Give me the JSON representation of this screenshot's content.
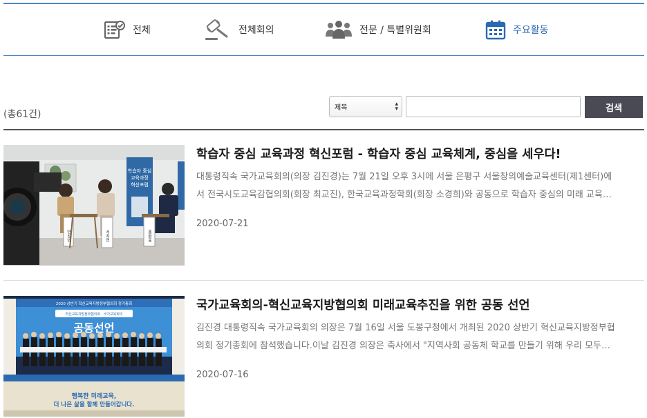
{
  "tabs": [
    {
      "label": "전체",
      "icon": "checklist-icon",
      "active": false
    },
    {
      "label": "전체회의",
      "icon": "gavel-icon",
      "active": false
    },
    {
      "label": "전문 / 특별위원회",
      "icon": "people-group-icon",
      "active": false
    },
    {
      "label": "주요활동",
      "icon": "calendar-icon",
      "active": true
    }
  ],
  "search": {
    "total_count": "(총61건)",
    "select_value": "제목",
    "input_value": "",
    "button_label": "검색"
  },
  "items": [
    {
      "title": "학습자 중심 교육과정 혁신포럼 - 학습자 중심 교육체계, 중심을 세우다!",
      "summary_line1": "대통령직속 국가교육회의(의장 김진경)는 7월 21일 오후 3시에 서울 은평구 서울창의예술교육센터(제1센터)에",
      "summary_line2": "서 전국시도교육감협의회(회장 최교진), 한국교육과정학회(회장 소경희)와 공동으로 학습자 중심의 미래 교육…",
      "date": "2020-07-21",
      "image": {
        "banner_text": "학습자 중심 교육과정 혁신포럼",
        "nameplates": [
          "안성빈",
          "서지연",
          "홍원표"
        ]
      }
    },
    {
      "title": "국가교육회의-혁신교육지방협의회 미래교육추진을 위한 공동 선언",
      "summary_line1": "김진경 대통령직속 국가교육회의 의장은 7월 16일 서울 도봉구청에서 개최된 2020 상반기 혁신교육지방정부협",
      "summary_line2": "의회 정기총회에 참석했습니다.이날 김진경 의장은 축사에서 \"지역사회 공동체 학교를 만들기 위해 우리 모두…",
      "date": "2020-07-16",
      "image": {
        "header_text": "2020 상반기 혁신교육지방정부협의회 정기총회",
        "sub_text": "혁신교육지방정부협의회 · 국가교육회의",
        "main_text": "공동선언",
        "bottom_text_1": "행복한 미래교육,",
        "bottom_text_2": "더 나은 삶을 함께 만들어갑니다."
      }
    }
  ]
}
